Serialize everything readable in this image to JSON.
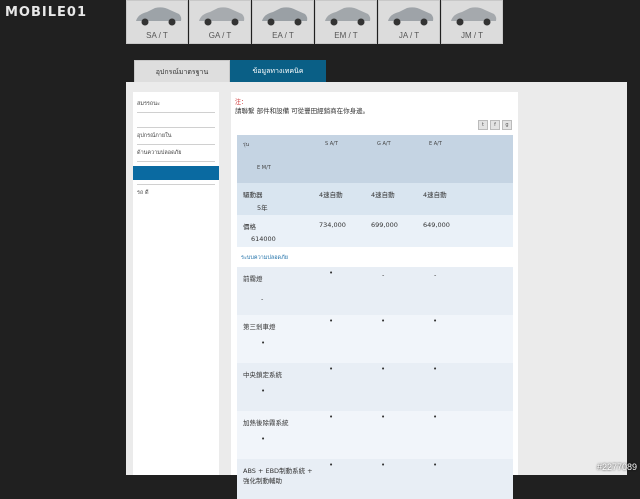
{
  "site": {
    "logo": "MOBILE01"
  },
  "car_tabs": [
    {
      "label": "SA / T"
    },
    {
      "label": "GA / T"
    },
    {
      "label": "EA / T"
    },
    {
      "label": "EM / T"
    },
    {
      "label": "JA / T"
    },
    {
      "label": "JM / T"
    }
  ],
  "tabs": {
    "standard": "อุปกรณ์มาตรฐาน",
    "specs": "ข้อมูลทางเทคนิค"
  },
  "sidebar": {
    "item1": "สมรรถนะ",
    "item2": "อุปกรณ์ภายใน",
    "item3": "ด้านความปลอดภัย",
    "item4": "",
    "item5": "รถ ดี"
  },
  "note": {
    "title": "注：",
    "text": "請聯繫 部件和設備 可從豐田經銷商在你身邊。"
  },
  "share_icons": [
    "t",
    "f",
    "g"
  ],
  "table": {
    "head": {
      "c0": "รุ่น",
      "c1": "S A/T",
      "c2": "G A/T",
      "c3": "E A/T",
      "c4": "E M/T"
    },
    "rows": [
      {
        "label": "驅動器",
        "v1": "4速自動",
        "v2": "4速自動",
        "v3": "4速自動",
        "extra": "5年"
      },
      {
        "label": "價格",
        "v1": "734,000",
        "v2": "699,000",
        "v3": "649,000",
        "extra": "614000"
      }
    ],
    "section_title": "ระบบความปลอดภัย",
    "safety": [
      {
        "label": "前霧燈",
        "v1": "•",
        "v2": "-",
        "v3": "-",
        "extra": "-"
      },
      {
        "label": "第三剎車燈",
        "v1": "•",
        "v2": "•",
        "v3": "•",
        "extra": "•"
      },
      {
        "label": "中央鎖定系統",
        "v1": "•",
        "v2": "•",
        "v3": "•",
        "extra": "•"
      },
      {
        "label": "加熱後除霧系統",
        "v1": "•",
        "v2": "•",
        "v3": "•",
        "extra": "•"
      },
      {
        "label": "ABS + EBD制動系統 + 強化制動輔助",
        "v1": "•",
        "v2": "•",
        "v3": "•",
        "extra": ""
      }
    ]
  },
  "watermark": "#2277089"
}
